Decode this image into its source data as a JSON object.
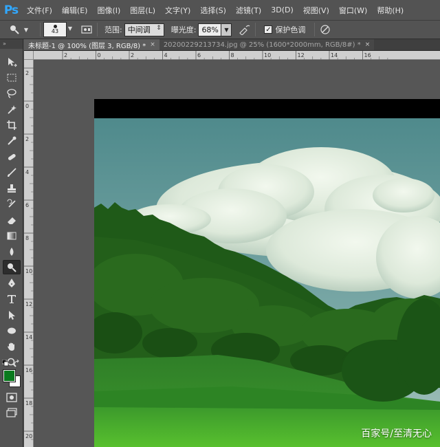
{
  "app": {
    "logo": "Ps",
    "menu": [
      "文件(F)",
      "编辑(E)",
      "图像(I)",
      "图层(L)",
      "文字(Y)",
      "选择(S)",
      "滤镜(T)",
      "3D(D)",
      "视图(V)",
      "窗口(W)",
      "帮助(H)"
    ]
  },
  "options": {
    "brush_size": "43",
    "range_label": "范围:",
    "range_value": "中间调",
    "exposure_label": "曝光度:",
    "exposure_value": "68%",
    "protect_label": "保护色调",
    "protect_checked": "✓"
  },
  "tabs": [
    {
      "label": "未标题-1 @ 100% (图层 3, RGB/8) *",
      "close": "×"
    },
    {
      "label": "20200229213734.jpg @ 25% (1600*2000mm, RGB/8#) *",
      "close": "×"
    }
  ],
  "rulers": {
    "top": [
      "2",
      "0",
      "2",
      "4",
      "6",
      "8",
      "10",
      "12",
      "14",
      "16"
    ],
    "left": [
      "2",
      "0",
      "2",
      "4",
      "6",
      "8",
      "10",
      "12",
      "14",
      "16",
      "18",
      "20"
    ]
  },
  "toolbox": {
    "collapse": "»",
    "tools": [
      "move-tool",
      "marquee-tool",
      "lasso-tool",
      "magic-wand-tool",
      "crop-tool",
      "eyedropper-tool",
      "healing-tool",
      "brush-tool",
      "stamp-tool",
      "history-brush-tool",
      "eraser-tool",
      "gradient-tool",
      "blur-tool",
      "dodge-tool",
      "pen-tool",
      "type-tool",
      "path-select-tool",
      "ellipse-tool",
      "hand-tool",
      "zoom-tool"
    ],
    "active_tool": "dodge-tool",
    "foreground_color": "#0a7a1e",
    "background_color": "#ffffff"
  },
  "canvas": {
    "watermark": "百家号/至清无心"
  }
}
